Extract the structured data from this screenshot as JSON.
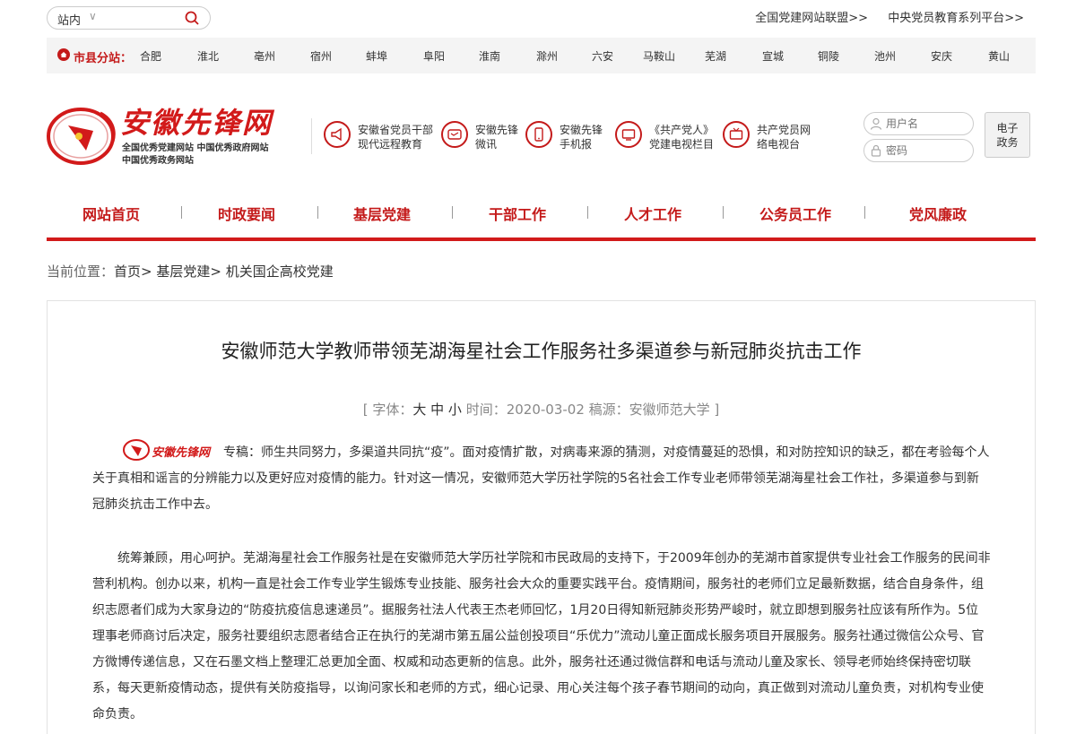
{
  "topbar": {
    "search_scope": "站内",
    "links": [
      "全国党建网站联盟>>",
      "中央党员教育系列平台>>"
    ]
  },
  "citybar": {
    "label": "市县分站：",
    "cities": [
      "合肥",
      "淮北",
      "亳州",
      "宿州",
      "蚌埠",
      "阜阳",
      "淮南",
      "滁州",
      "六安",
      "马鞍山",
      "芜湖",
      "宣城",
      "铜陵",
      "池州",
      "安庆",
      "黄山"
    ]
  },
  "header": {
    "logo_name": "安徽先锋网",
    "logo_sub1": "全国优秀党建网站  中国优秀政府网站",
    "logo_sub2": "中国优秀政务网站",
    "features": [
      {
        "icon": "horn-icon",
        "l1": "安徽省党员干部",
        "l2": "现代远程教育"
      },
      {
        "icon": "wechat-icon",
        "l1": "安徽先锋",
        "l2": "微讯"
      },
      {
        "icon": "mobile-icon",
        "l1": "安徽先锋",
        "l2": "手机报"
      },
      {
        "icon": "tv-icon",
        "l1": "《共产党人》",
        "l2": "党建电视栏目"
      },
      {
        "icon": "tv-channel-icon",
        "l1": "共产党员网",
        "l2": "络电视台"
      }
    ],
    "username_placeholder": "用户名",
    "password_placeholder": "密码",
    "egov_line1": "电子",
    "egov_line2": "政务"
  },
  "nav": [
    "网站首页",
    "时政要闻",
    "基层党建",
    "干部工作",
    "人才工作",
    "公务员工作",
    "党风廉政"
  ],
  "breadcrumb": {
    "label": "当前位置：",
    "trail": "首页> 基层党建> 机关国企高校党建"
  },
  "article": {
    "title": "安徽师范大学教师带领芜湖海星社会工作服务社多渠道参与新冠肺炎抗击工作",
    "meta_open": "[ 字体：",
    "size_large": "大",
    "size_medium": "中",
    "size_small": "小",
    "meta_rest": " 时间：2020-03-02 稿源：安徽师范大学 ]",
    "inline_logo": "安徽先锋网",
    "p1": "专稿：师生共同努力，多渠道共同抗“疫”。面对疫情扩散，对病毒来源的猜测，对疫情蔓延的恐惧，和对防控知识的缺乏，都在考验每个人关于真相和谣言的分辨能力以及更好应对疫情的能力。针对这一情况，安徽师范大学历社学院的5名社会工作专业老师带领芜湖海星社会工作社，多渠道参与到新冠肺炎抗击工作中去。",
    "p2": "统筹兼顾，用心呵护。芜湖海星社会工作服务社是在安徽师范大学历社学院和市民政局的支持下，于2009年创办的芜湖市首家提供专业社会工作服务的民间非营利机构。创办以来，机构一直是社会工作专业学生锻炼专业技能、服务社会大众的重要实践平台。疫情期间，服务社的老师们立足最新数据，结合自身条件，组织志愿者们成为大家身边的“防疫抗疫信息速递员”。据服务社法人代表王杰老师回忆，1月20日得知新冠肺炎形势严峻时，就立即想到服务社应该有所作为。5位理事老师商讨后决定，服务社要组织志愿者结合正在执行的芜湖市第五届公益创投项目“乐优力”流动儿童正面成长服务项目开展服务。服务社通过微信公众号、官方微博传递信息，又在石墨文档上整理汇总更加全面、权威和动态更新的信息。此外，服务社还通过微信群和电话与流动儿童及家长、领导老师始终保持密切联系，每天更新疫情动态，提供有关防疫指导，以询问家长和老师的方式，细心记录、用心关注每个孩子春节期间的动向，真正做到对流动儿童负责，对机构专业使命负责。"
  },
  "colors": {
    "brand_red": "#d21a1a"
  }
}
